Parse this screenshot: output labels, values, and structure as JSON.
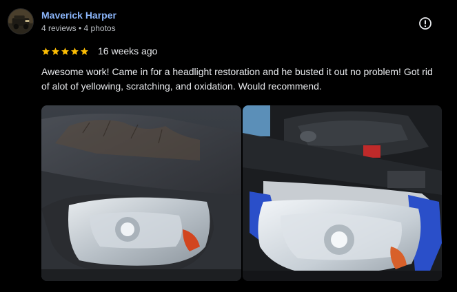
{
  "author": {
    "name": "Maverick Harper",
    "meta": "4 reviews • 4 photos",
    "avatar_icon": "avatar-photo"
  },
  "review": {
    "rating": 5,
    "max_rating": 5,
    "star_color": "#fbbc04",
    "time": "16 weeks ago",
    "text": "Awesome work! Came in for a headlight restoration and he busted it out no problem! Got rid of alot of yellowing, scratching, and oxidation. Would recommend."
  },
  "actions": {
    "more_icon": "exclamation-circle-icon"
  },
  "photos": [
    {
      "subject": "restored headlight on gray truck, exterior view"
    },
    {
      "subject": "headlight with blue masking tape, engine bay visible"
    }
  ],
  "colors": {
    "background": "#000000",
    "name_link": "#8ab4f8",
    "text": "#e8eaed",
    "meta_text": "#bdc1c6"
  }
}
